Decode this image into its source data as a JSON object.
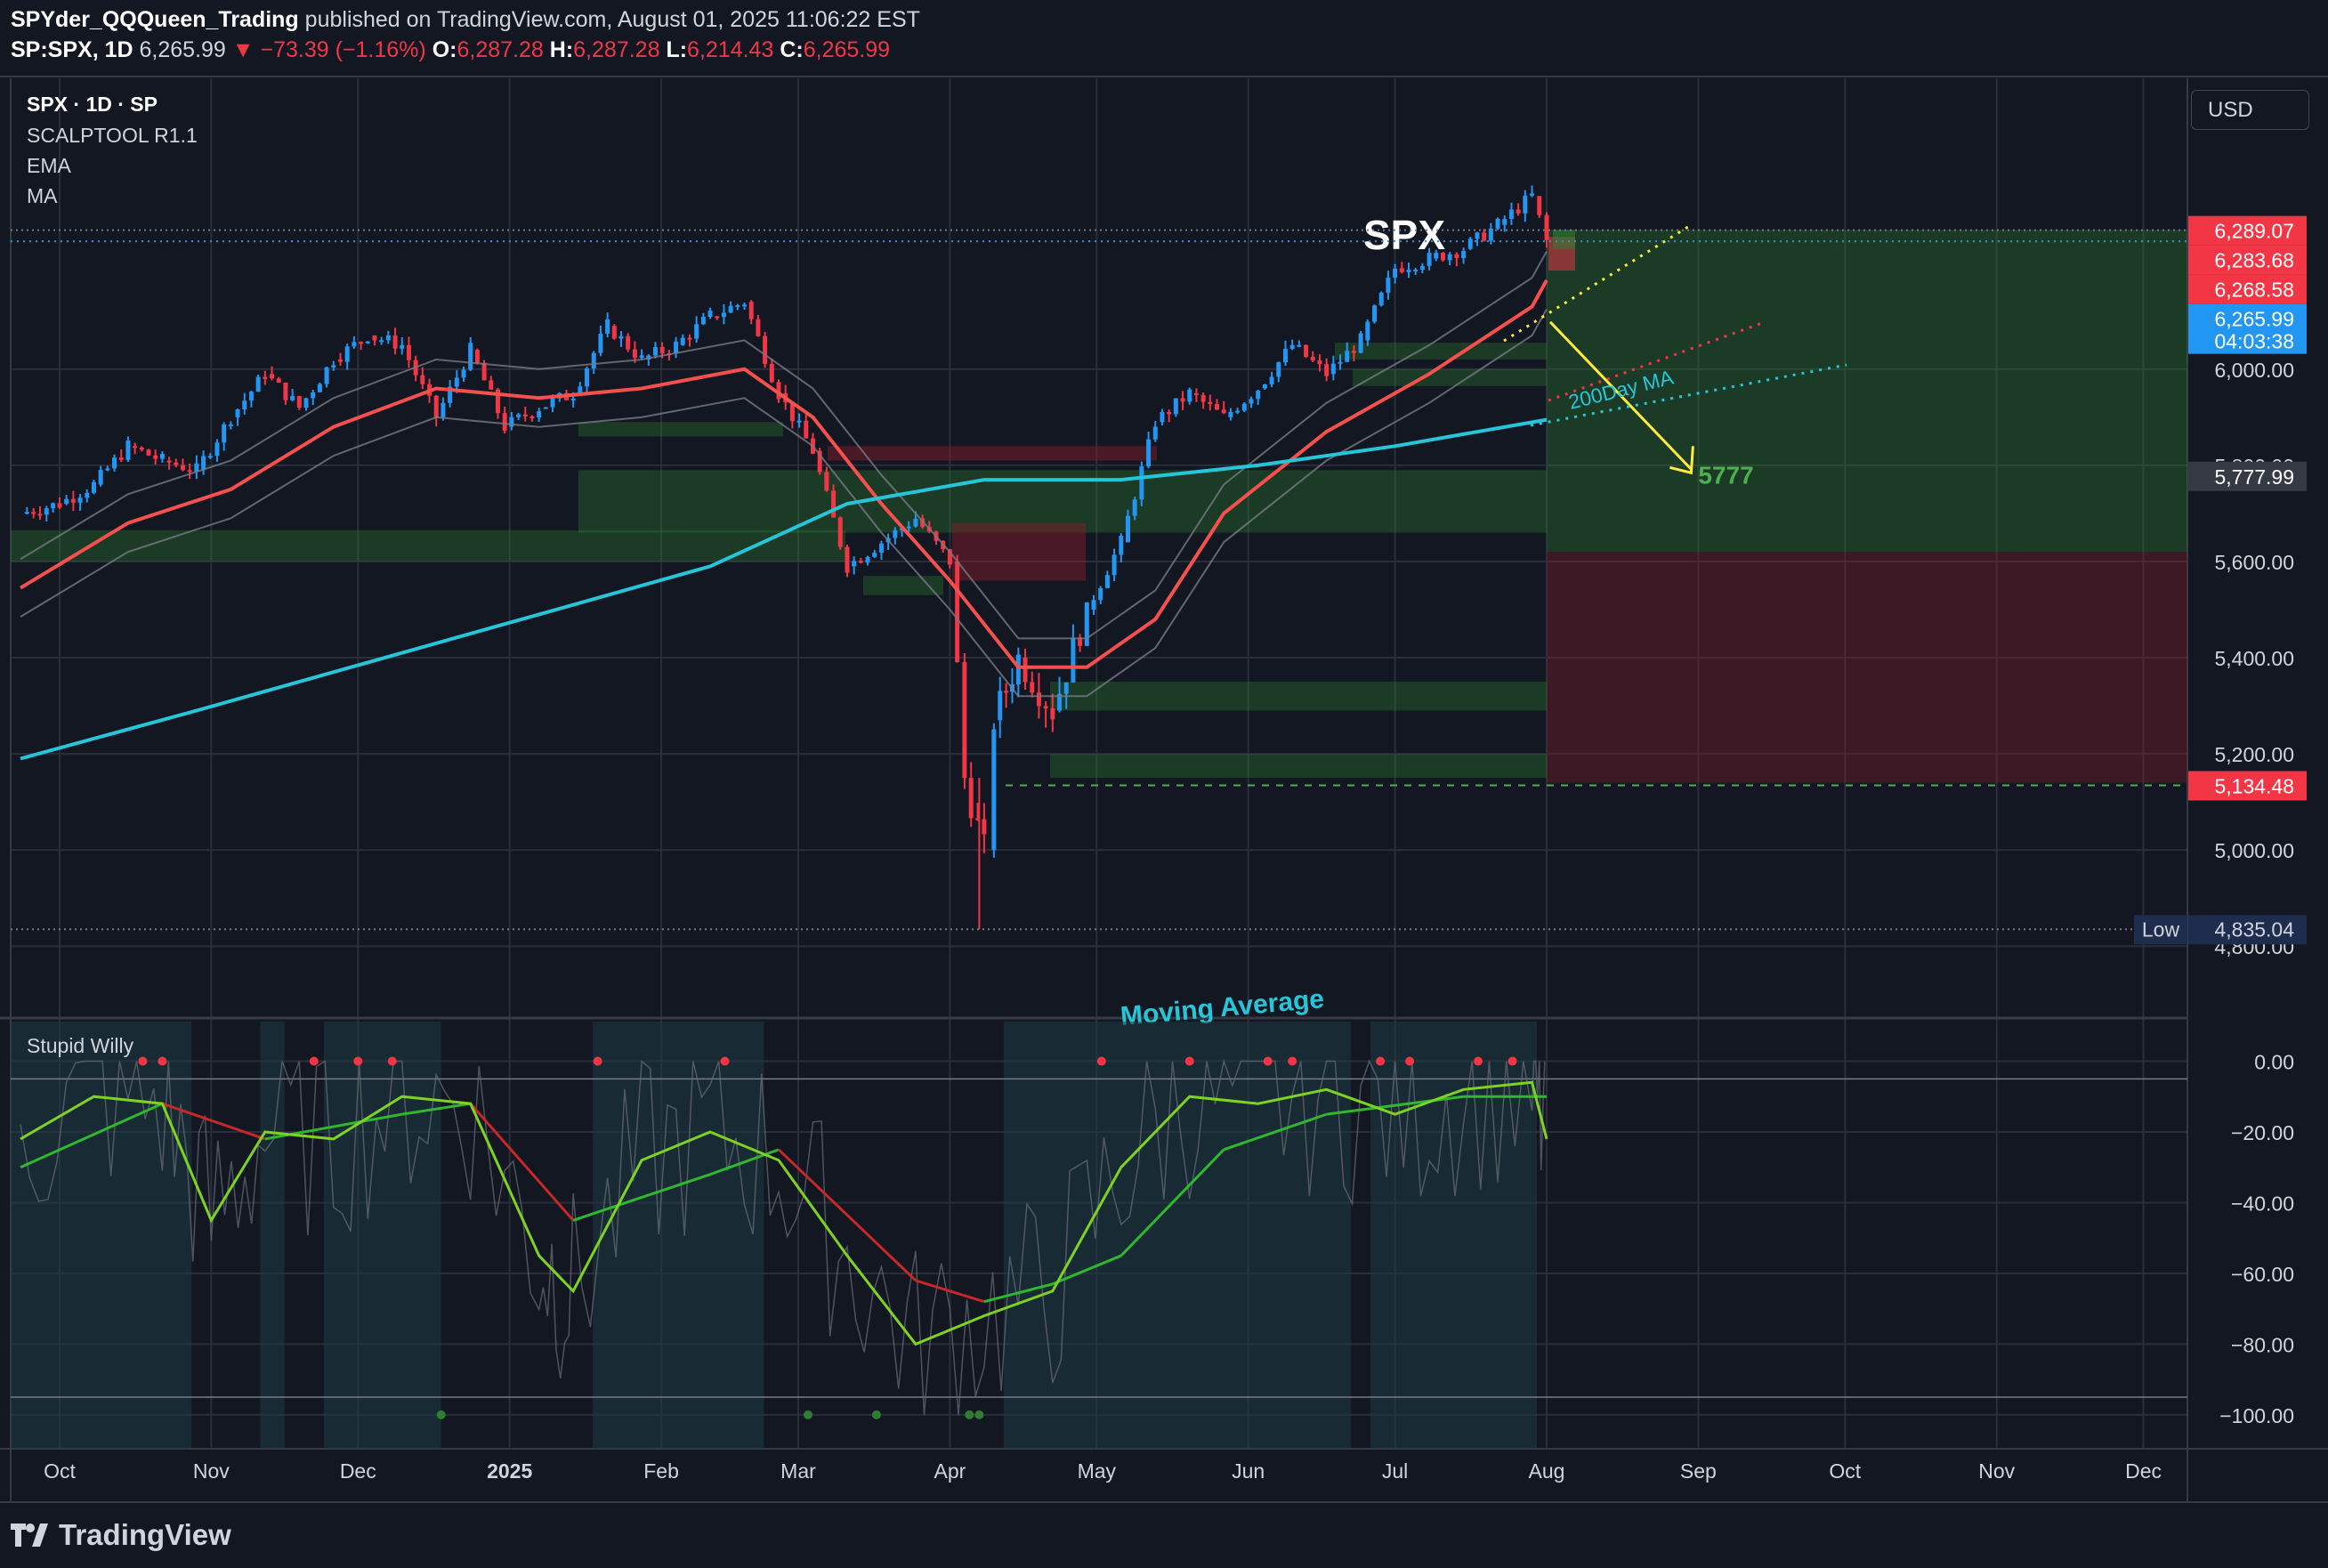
{
  "header": {
    "author": "SPYder_QQQueen_Trading",
    "published": "published on TradingView.com, August 01, 2025 11:06:22 EST",
    "symbol": "SP:SPX, 1D",
    "last": "6,265.99",
    "change_arrow": "▼",
    "change": "−73.39 (−1.16%)",
    "o_label": "O:",
    "o_val": "6,287.28",
    "h_label": "H:",
    "h_val": "6,287.28",
    "l_label": "L:",
    "l_val": "6,214.43",
    "c_label": "C:",
    "c_val": "6,265.99"
  },
  "legend": {
    "line1": "SPX · 1D · SP",
    "line2": "SCALPTOOL R1.1",
    "line3": "EMA",
    "line4": "MA",
    "oscillator": "Stupid Willy"
  },
  "currency_button": "USD",
  "annotations": {
    "title": "SPX",
    "target": "5777",
    "ma_label": "200Day MA",
    "ma_text": "Moving Average"
  },
  "price_tags": [
    {
      "value": 6289.07,
      "text": "6,289.07",
      "color": "#f23645"
    },
    {
      "value": 6283.68,
      "text": "6,283.68",
      "color": "#f23645"
    },
    {
      "value": 6268.58,
      "text": "6,268.58",
      "color": "#f23645"
    },
    {
      "value": 6265.99,
      "text": "6,265.99",
      "text2": "04:03:38",
      "color": "#2196f3"
    },
    {
      "value": 5777.99,
      "text": "5,777.99",
      "color": "#363a45"
    },
    {
      "value": 5134.48,
      "text": "5,134.48",
      "color": "#f23645"
    }
  ],
  "low_tag": {
    "label": "Low",
    "value": 4835.04,
    "text": "4,835.04"
  },
  "footer": {
    "brand": "TradingView"
  },
  "colors": {
    "bg": "#131722",
    "grid": "#2a2e39",
    "up": "#2196f3",
    "down": "#f23645",
    "ema": "#f5504e",
    "ma200": "#26c6da",
    "osc_fast": "#7ed321",
    "osc_slow_up": "#2eb82e",
    "osc_slow_down": "#c62828",
    "arrow": "#ffeb3b"
  },
  "chart_data": [
    {
      "type": "line",
      "title": "SPX",
      "y_ticks": [
        6000,
        5800,
        5600,
        5400,
        5200,
        5000,
        4800
      ],
      "y_tick_labels": [
        "6,000.00",
        "5,800.00",
        "5,600.00",
        "5,400.00",
        "5,200.00",
        "5,000.00",
        "4,800.00"
      ],
      "x_ticks": [
        "Oct",
        "Nov",
        "Dec",
        "2025",
        "Feb",
        "Mar",
        "Apr",
        "May",
        "Jun",
        "Jul",
        "Aug",
        "Sep",
        "Oct",
        "Nov",
        "Dec"
      ],
      "x_tick_dates": [
        "2024-10-01",
        "2024-11-01",
        "2024-12-01",
        "2025-01-01",
        "2025-02-01",
        "2025-03-01",
        "2025-04-01",
        "2025-05-01",
        "2025-06-01",
        "2025-07-01",
        "2025-08-01",
        "2025-09-01",
        "2025-10-01",
        "2025-11-01",
        "2025-12-01"
      ],
      "ylim": [
        4770,
        6430
      ],
      "series": [
        {
          "name": "Close",
          "x": [
            "2024-09-23",
            "2024-10-01",
            "2024-10-08",
            "2024-10-15",
            "2024-10-22",
            "2024-10-29",
            "2024-11-05",
            "2024-11-12",
            "2024-11-19",
            "2024-11-26",
            "2024-12-03",
            "2024-12-10",
            "2024-12-17",
            "2024-12-24",
            "2024-12-31",
            "2025-01-07",
            "2025-01-14",
            "2025-01-21",
            "2025-01-28",
            "2025-02-04",
            "2025-02-11",
            "2025-02-18",
            "2025-02-25",
            "2025-03-04",
            "2025-03-11",
            "2025-03-18",
            "2025-03-25",
            "2025-04-01",
            "2025-04-04",
            "2025-04-08",
            "2025-04-10",
            "2025-04-15",
            "2025-04-22",
            "2025-04-29",
            "2025-05-06",
            "2025-05-13",
            "2025-05-20",
            "2025-05-27",
            "2025-06-03",
            "2025-06-10",
            "2025-06-17",
            "2025-06-24",
            "2025-07-01",
            "2025-07-08",
            "2025-07-15",
            "2025-07-22",
            "2025-07-29",
            "2025-08-01"
          ],
          "values": [
            5700,
            5720,
            5760,
            5840,
            5810,
            5790,
            5900,
            5990,
            5920,
            6020,
            6070,
            6050,
            5900,
            6040,
            5880,
            5920,
            5950,
            6090,
            6020,
            6050,
            6110,
            6140,
            5950,
            5830,
            5590,
            5640,
            5690,
            5600,
            5150,
            5000,
            5270,
            5400,
            5290,
            5500,
            5640,
            5890,
            5950,
            5900,
            5960,
            6050,
            5990,
            6060,
            6210,
            6230,
            6250,
            6300,
            6360,
            6266
          ]
        },
        {
          "name": "EMA",
          "x": [
            "2024-09-23",
            "2024-10-15",
            "2024-11-05",
            "2024-11-26",
            "2024-12-17",
            "2025-01-07",
            "2025-01-28",
            "2025-02-18",
            "2025-03-04",
            "2025-03-18",
            "2025-04-01",
            "2025-04-15",
            "2025-04-29",
            "2025-05-13",
            "2025-05-27",
            "2025-06-17",
            "2025-07-08",
            "2025-07-29",
            "2025-08-01"
          ],
          "values": [
            5545,
            5680,
            5750,
            5880,
            5960,
            5940,
            5960,
            6000,
            5900,
            5720,
            5560,
            5380,
            5380,
            5480,
            5700,
            5870,
            5990,
            6130,
            6185
          ]
        },
        {
          "name": "200Day MA",
          "x": [
            "2024-09-23",
            "2024-10-29",
            "2024-12-03",
            "2025-01-07",
            "2025-02-11",
            "2025-03-11",
            "2025-04-08",
            "2025-05-06",
            "2025-06-03",
            "2025-07-01",
            "2025-08-01"
          ],
          "values": [
            5190,
            5290,
            5390,
            5490,
            5590,
            5720,
            5770,
            5770,
            5800,
            5840,
            5895
          ]
        }
      ],
      "projection": {
        "from": "2025-08-01",
        "to": "2025-09-01",
        "from_value": 6200,
        "to_value": 5777
      },
      "last_price": 6265.99,
      "low": 4835.04
    },
    {
      "type": "line",
      "title": "Stupid Willy",
      "y_ticks": [
        0,
        -20,
        -40,
        -60,
        -80,
        -100
      ],
      "y_tick_labels": [
        "0.00",
        "−20.00",
        "−40.00",
        "−60.00",
        "−80.00",
        "−100.00"
      ],
      "ylim": [
        -110,
        5
      ],
      "series": [
        {
          "name": "Fast",
          "x": [
            "2024-09-23",
            "2024-10-08",
            "2024-10-22",
            "2024-11-01",
            "2024-11-12",
            "2024-11-26",
            "2024-12-10",
            "2024-12-24",
            "2025-01-07",
            "2025-01-14",
            "2025-01-28",
            "2025-02-11",
            "2025-02-25",
            "2025-03-11",
            "2025-03-25",
            "2025-04-08",
            "2025-04-22",
            "2025-05-06",
            "2025-05-20",
            "2025-06-03",
            "2025-06-17",
            "2025-07-01",
            "2025-07-15",
            "2025-07-29",
            "2025-08-01"
          ],
          "values": [
            -22,
            -10,
            -12,
            -45,
            -20,
            -22,
            -10,
            -12,
            -55,
            -65,
            -28,
            -20,
            -28,
            -55,
            -80,
            -72,
            -65,
            -30,
            -10,
            -12,
            -8,
            -15,
            -8,
            -6,
            -22
          ]
        },
        {
          "name": "Slow",
          "x": [
            "2024-09-23",
            "2024-10-22",
            "2024-11-12",
            "2024-12-10",
            "2024-12-24",
            "2025-01-14",
            "2025-02-11",
            "2025-02-25",
            "2025-03-25",
            "2025-04-08",
            "2025-04-22",
            "2025-05-06",
            "2025-05-27",
            "2025-06-17",
            "2025-07-15",
            "2025-08-01"
          ],
          "values": [
            -30,
            -12,
            -22,
            -15,
            -12,
            -45,
            -32,
            -25,
            -62,
            -68,
            -63,
            -55,
            -25,
            -15,
            -10,
            -10
          ]
        }
      ]
    }
  ]
}
